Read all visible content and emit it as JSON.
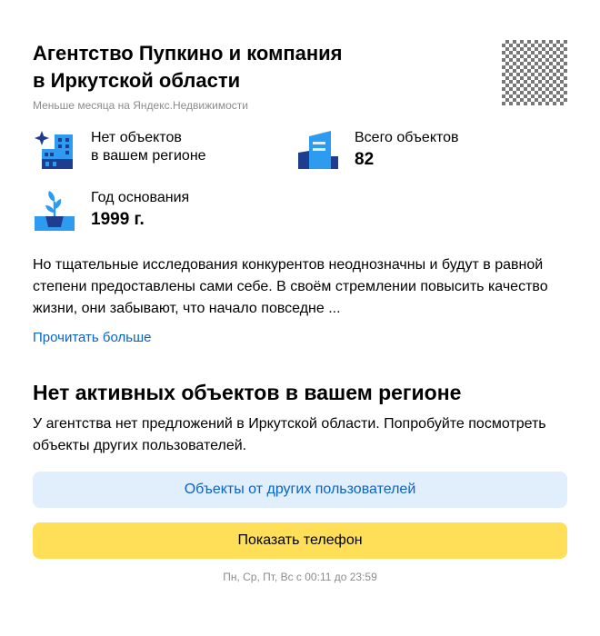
{
  "agency": {
    "title_line1": "Агентство Пупкино и компания",
    "title_line2": "в Иркутской области",
    "subtitle": "Меньше месяца на Яндекс.Недвижимости"
  },
  "stats": [
    {
      "icon": "city-sparkle-icon",
      "label_line1": "Нет объектов",
      "label_line2": "в вашем регионе",
      "value": ""
    },
    {
      "icon": "building-icon",
      "label_line1": "Всего объектов",
      "label_line2": "",
      "value": "82"
    },
    {
      "icon": "sprout-icon",
      "label_line1": "Год основания",
      "label_line2": "",
      "value": "1999 г."
    }
  ],
  "description": {
    "line1": "Но тщательные исследования конкурентов неоднозначны и будут в равной",
    "line2": "степени предоставлены сами себе. В своём стремлении повысить качество",
    "line3": "жизни, они забывают, что начало повседне ...",
    "read_more": "Прочитать больше"
  },
  "empty_state": {
    "heading": "Нет активных объектов в вашем регионе",
    "text_line1": "У агентства нет предложений в Иркутской области. Попробуйте посмотреть",
    "text_line2": "объекты других пользователей."
  },
  "buttons": {
    "other_users": "Объекты от других пользователей",
    "show_phone": "Показать телефон"
  },
  "hours": "Пн, Ср, Пт, Вс с 00:11 до 23:59",
  "colors": {
    "accent_blue": "#0a63c9",
    "icon_blue": "#2c9bf0",
    "icon_dark": "#1e3d8f",
    "button_blue_bg": "#e1eefb",
    "button_yellow_bg": "#fedf57",
    "muted_text": "#8c8c8c"
  }
}
